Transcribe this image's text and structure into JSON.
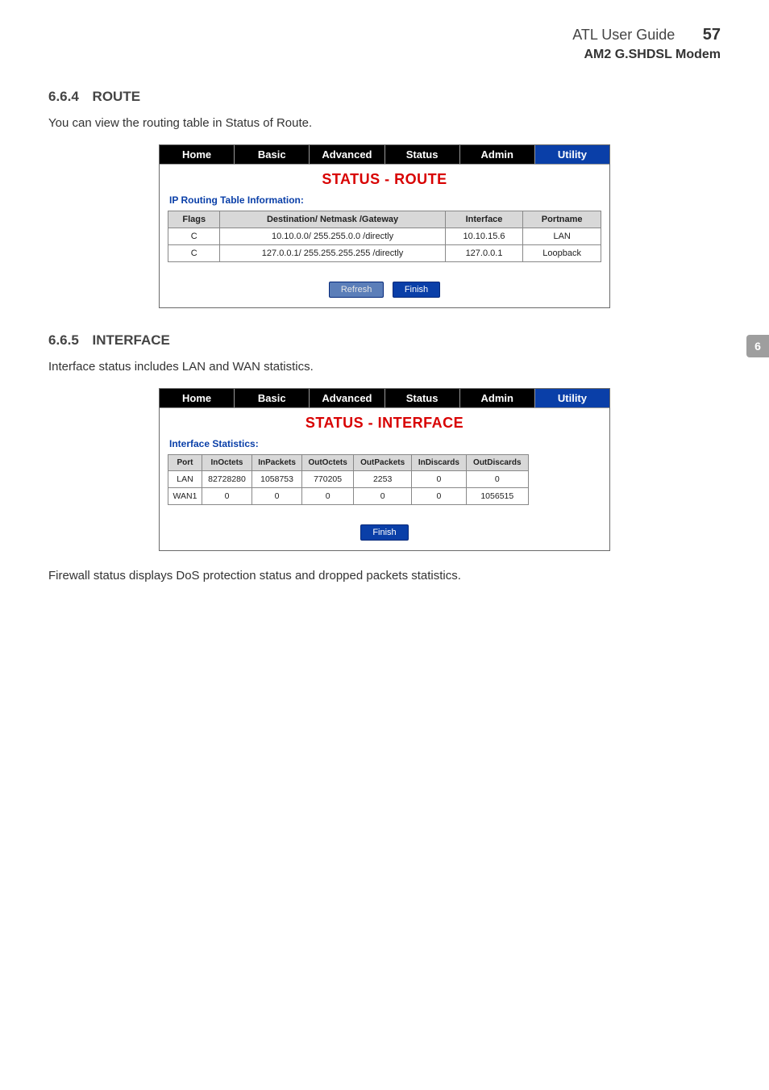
{
  "header": {
    "guide": "ATL User Guide",
    "page_number": "57",
    "product": "AM2 G.SHDSL Modem"
  },
  "side_tab": "6",
  "sections": {
    "route": {
      "heading_num": "6.6.4",
      "heading_title": "ROUTE",
      "body": "You can view the routing table in Status of Route."
    },
    "interface": {
      "heading_num": "6.6.5",
      "heading_title": "INTERFACE",
      "body": "Interface status includes LAN and WAN statistics."
    },
    "firewall_text": "Firewall status displays DoS protection status and dropped packets statistics."
  },
  "screenshot_route": {
    "tabs": [
      "Home",
      "Basic",
      "Advanced",
      "Status",
      "Admin",
      "Utility"
    ],
    "title": "STATUS - ROUTE",
    "subtitle": "IP Routing Table Information:",
    "columns": [
      "Flags",
      "Destination/ Netmask /Gateway",
      "Interface",
      "Portname"
    ],
    "rows": [
      {
        "flags": "C",
        "dest": "10.10.0.0/ 255.255.0.0 /directly",
        "iface": "10.10.15.6",
        "port": "LAN"
      },
      {
        "flags": "C",
        "dest": "127.0.0.1/ 255.255.255.255 /directly",
        "iface": "127.0.0.1",
        "port": "Loopback"
      }
    ],
    "buttons": {
      "refresh": "Refresh",
      "finish": "Finish"
    }
  },
  "screenshot_interface": {
    "tabs": [
      "Home",
      "Basic",
      "Advanced",
      "Status",
      "Admin",
      "Utility"
    ],
    "title": "STATUS - INTERFACE",
    "subtitle": "Interface Statistics:",
    "columns": [
      "Port",
      "InOctets",
      "InPackets",
      "OutOctets",
      "OutPackets",
      "InDiscards",
      "OutDiscards"
    ],
    "rows": [
      {
        "c0": "LAN",
        "c1": "82728280",
        "c2": "1058753",
        "c3": "770205",
        "c4": "2253",
        "c5": "0",
        "c6": "0"
      },
      {
        "c0": "WAN1",
        "c1": "0",
        "c2": "0",
        "c3": "0",
        "c4": "0",
        "c5": "0",
        "c6": "1056515"
      }
    ],
    "buttons": {
      "finish": "Finish"
    }
  }
}
